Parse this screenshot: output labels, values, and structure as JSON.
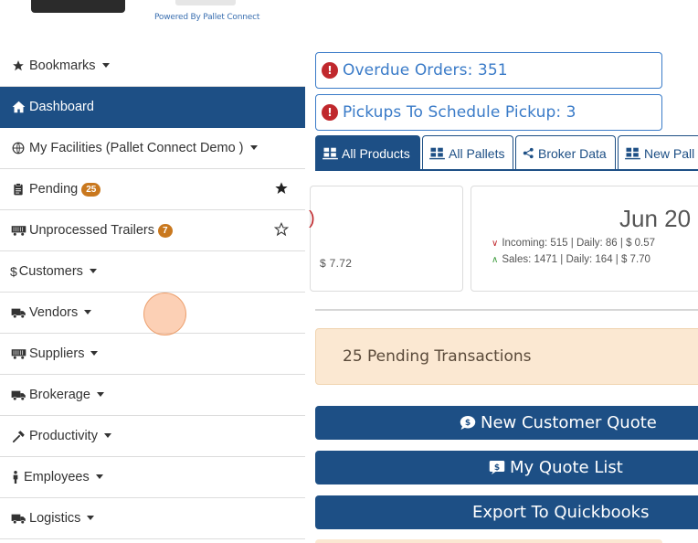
{
  "header": {
    "powered_by": "Powered By Pallet Connect"
  },
  "sidebar": {
    "items": [
      {
        "label": "Bookmarks",
        "icon": "star-icon"
      },
      {
        "label": "Dashboard",
        "icon": "home-icon"
      },
      {
        "label": "My Facilities (Pallet Connect Demo )",
        "icon": "globe-icon"
      },
      {
        "label": "Pending",
        "icon": "clipboard-icon",
        "badge": "25"
      },
      {
        "label": "Unprocessed Trailers",
        "icon": "trailer-icon",
        "badge": "7"
      },
      {
        "label": "Customers",
        "icon": "dollar-icon"
      },
      {
        "label": "Vendors",
        "icon": "truck-icon"
      },
      {
        "label": "Suppliers",
        "icon": "trailer-icon"
      },
      {
        "label": "Brokerage",
        "icon": "truck-icon"
      },
      {
        "label": "Productivity",
        "icon": "hammer-icon"
      },
      {
        "label": "Employees",
        "icon": "person-icon"
      },
      {
        "label": "Logistics",
        "icon": "truck-icon"
      }
    ]
  },
  "alerts": {
    "overdue": "Overdue Orders: 351",
    "pickups": "Pickups To Schedule Pickup: 3"
  },
  "tabs": [
    {
      "label": "All Products",
      "active": true
    },
    {
      "label": "All Pallets",
      "active": false
    },
    {
      "label": "Broker Data",
      "active": false
    },
    {
      "label": "New Pall",
      "active": false
    }
  ],
  "cards": {
    "left_amount": "$ 7.72",
    "right_date": "Jun 20",
    "incoming": "Incoming: 515 | Daily: 86 | $ 0.57",
    "sales": "Sales: 1471 | Daily: 164 | $ 7.70"
  },
  "pending_panel": "25 Pending Transactions",
  "buttons": {
    "new_quote": "New Customer Quote",
    "quote_list": "My Quote List",
    "export": "Export To Quickbooks"
  },
  "colors": {
    "primary": "#1d4f85",
    "badge": "#c9781e",
    "alert_red": "#c0282d",
    "pending_bg": "#fbe8d2"
  }
}
